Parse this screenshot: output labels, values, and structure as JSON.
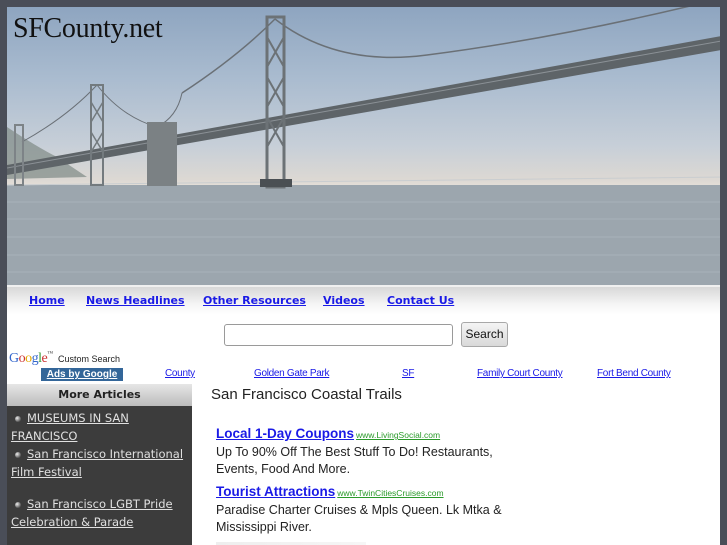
{
  "site": {
    "title": "SFCounty.net"
  },
  "nav": {
    "items": [
      {
        "label": "Home"
      },
      {
        "label": "News Headlines"
      },
      {
        "label": "Other Resources"
      },
      {
        "label": "Videos"
      },
      {
        "label": "Contact Us"
      }
    ]
  },
  "search": {
    "value": "",
    "placeholder": "",
    "button_label": "Search",
    "google_logo": "Google",
    "google_tm": "™",
    "custom_search_label": "Custom Search"
  },
  "ads_bar": {
    "label": "Ads by Google",
    "links": [
      {
        "label": "County"
      },
      {
        "label": "Golden Gate Park"
      },
      {
        "label": "SF"
      },
      {
        "label": "Family Court County"
      },
      {
        "label": "Fort Bend County"
      }
    ]
  },
  "sidebar": {
    "header": "More Articles",
    "items": [
      {
        "label": "MUSEUMS IN SAN FRANCISCO"
      },
      {
        "label": "San Francisco International Film Festival"
      },
      {
        "label": "San Francisco LGBT Pride Celebration & Parade"
      }
    ]
  },
  "main": {
    "title": "San Francisco Coastal Trails",
    "ads": [
      {
        "title": "Local 1-Day Coupons",
        "url": "www.LivingSocial.com",
        "description": "Up To 90% Off The Best Stuff To Do! Restaurants, Events, Food And More."
      },
      {
        "title": "Tourist Attractions",
        "url": "www.TwinCitiesCruises.com",
        "description": "Paradise Charter Cruises & Mpls Queen. Lk Mtka & Mississippi River."
      }
    ]
  },
  "colors": {
    "link": "#1a1ae6",
    "ad_url": "#2a9a2a",
    "sidebar_bg": "#3c3c3c",
    "ads_label_bg": "#336699",
    "frame": "#4a4e58"
  }
}
